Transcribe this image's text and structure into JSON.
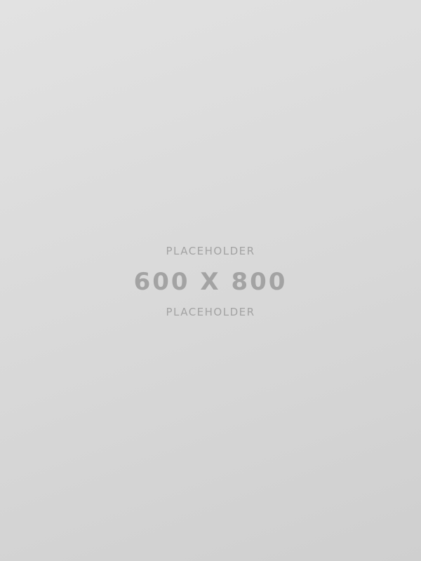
{
  "placeholder": {
    "top_label": "PLACEHOLDER",
    "dimensions": "600 X 800",
    "bottom_label": "PLACEHOLDER",
    "colors": {
      "background_light": "#e2e2e2",
      "background_dark": "#cfcfcf",
      "text": "#a3a3a3"
    }
  }
}
